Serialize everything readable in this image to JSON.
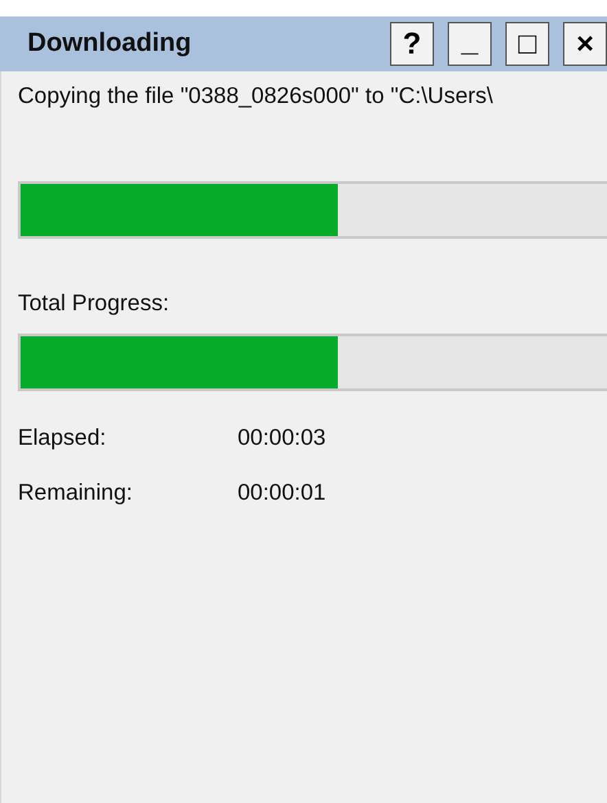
{
  "window": {
    "title": "Downloading",
    "buttons": [
      {
        "kind": "help",
        "label": "?"
      },
      {
        "kind": "minimize",
        "label": "_"
      },
      {
        "kind": "maximize",
        "label": "□"
      },
      {
        "kind": "close",
        "label": "×"
      }
    ]
  },
  "message": "Copying the file \"0388_0826s000\" to \"C:\\Users\\",
  "file_progress": {
    "level": 0.525
  },
  "total_progress": {
    "label": "Total Progress:",
    "level": 0.525
  },
  "times": [
    {
      "label": "Elapsed:",
      "value": "00:00:03"
    },
    {
      "label": "Remaining:",
      "value": "00:00:01"
    }
  ]
}
